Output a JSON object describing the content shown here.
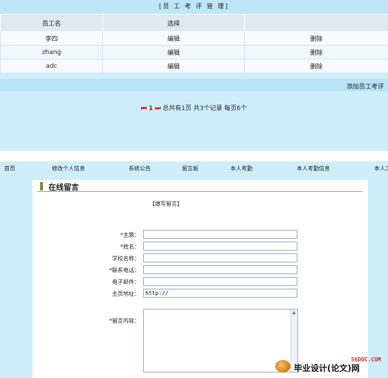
{
  "top": {
    "title": "[员 工 考 评 管 理]",
    "table": {
      "headers": [
        "员工名",
        "选择",
        ""
      ],
      "rows": [
        {
          "name": "李四",
          "edit": "编辑",
          "delete": "删除"
        },
        {
          "name": "zhang",
          "edit": "编辑",
          "delete": "删除"
        },
        {
          "name": "adc",
          "edit": "编辑",
          "delete": "删除"
        }
      ]
    },
    "add_review": "添加员工考评",
    "pager": {
      "first_icon": "⏮",
      "page": "1",
      "last_icon": "⏭",
      "summary": "总共有1页 共3个记录 每页6个"
    }
  },
  "nav": {
    "items": [
      "首页",
      "修改个人信息",
      "系统公告",
      "留言板",
      "本人考勤",
      "本人考勤信息",
      "本人工"
    ]
  },
  "message": {
    "title": "在线留言",
    "form_header": "【填写留言】",
    "fields": [
      {
        "label": "*主题：",
        "value": ""
      },
      {
        "label": "*姓名：",
        "value": ""
      },
      {
        "label": "学校名称：",
        "value": ""
      },
      {
        "label": "*联系电话：",
        "value": ""
      },
      {
        "label": "电子邮件：",
        "value": ""
      },
      {
        "label": "主页地址：",
        "value": "http://"
      }
    ],
    "content_label": "*留言内容：",
    "content_value": ""
  },
  "watermark": {
    "site": "56DOC.COM",
    "text": "毕业设计(论文)网"
  },
  "colors": {
    "panel_bg": "#cfeefb",
    "header_bg": "#e0e8f0",
    "pager_red": "#d20000"
  }
}
